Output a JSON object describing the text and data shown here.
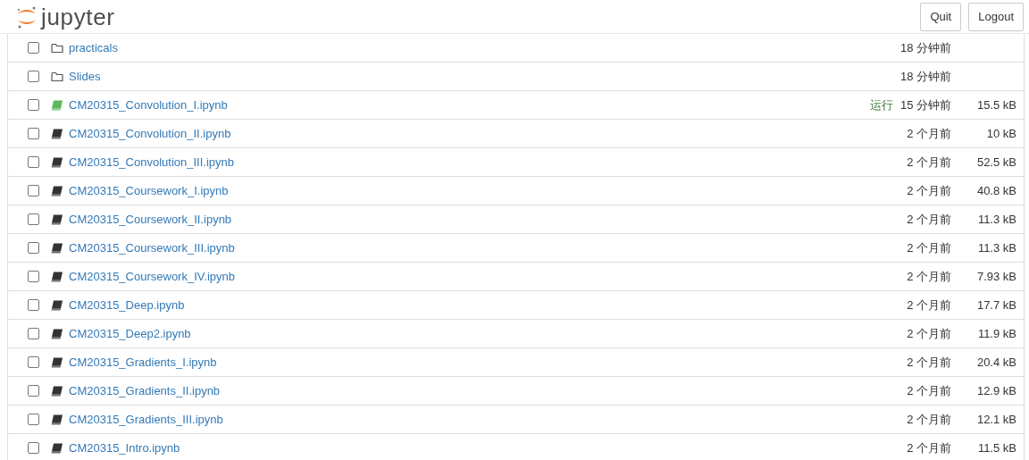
{
  "header": {
    "logo_text": "jupyter",
    "buttons": [
      "Quit",
      "Logout"
    ]
  },
  "items": [
    {
      "kind": "folder",
      "name": "practicals",
      "checked": false,
      "modified": "18 分钟前"
    },
    {
      "kind": "folder",
      "name": "Slides",
      "checked": false,
      "modified": "18 分钟前"
    },
    {
      "kind": "notebook",
      "name": "CM20315_Convolution_I.ipynb",
      "checked": false,
      "running": true,
      "status": "运行",
      "modified": "15 分钟前",
      "size": "15.5 kB"
    },
    {
      "kind": "notebook",
      "name": "CM20315_Convolution_II.ipynb",
      "checked": false,
      "running": false,
      "modified": "2 个月前",
      "size": "10 kB"
    },
    {
      "kind": "notebook",
      "name": "CM20315_Convolution_III.ipynb",
      "checked": false,
      "running": false,
      "modified": "2 个月前",
      "size": "52.5 kB"
    },
    {
      "kind": "notebook",
      "name": "CM20315_Coursework_I.ipynb",
      "checked": false,
      "running": false,
      "modified": "2 个月前",
      "size": "40.8 kB"
    },
    {
      "kind": "notebook",
      "name": "CM20315_Coursework_II.ipynb",
      "checked": false,
      "running": false,
      "modified": "2 个月前",
      "size": "11.3 kB"
    },
    {
      "kind": "notebook",
      "name": "CM20315_Coursework_III.ipynb",
      "checked": false,
      "running": false,
      "modified": "2 个月前",
      "size": "11.3 kB"
    },
    {
      "kind": "notebook",
      "name": "CM20315_Coursework_IV.ipynb",
      "checked": false,
      "running": false,
      "modified": "2 个月前",
      "size": "7.93 kB"
    },
    {
      "kind": "notebook",
      "name": "CM20315_Deep.ipynb",
      "checked": false,
      "running": false,
      "modified": "2 个月前",
      "size": "17.7 kB"
    },
    {
      "kind": "notebook",
      "name": "CM20315_Deep2.ipynb",
      "checked": false,
      "running": false,
      "modified": "2 个月前",
      "size": "11.9 kB"
    },
    {
      "kind": "notebook",
      "name": "CM20315_Gradients_I.ipynb",
      "checked": false,
      "running": false,
      "modified": "2 个月前",
      "size": "20.4 kB"
    },
    {
      "kind": "notebook",
      "name": "CM20315_Gradients_II.ipynb",
      "checked": false,
      "running": false,
      "modified": "2 个月前",
      "size": "12.9 kB"
    },
    {
      "kind": "notebook",
      "name": "CM20315_Gradients_III.ipynb",
      "checked": false,
      "running": false,
      "modified": "2 个月前",
      "size": "12.1 kB"
    },
    {
      "kind": "notebook",
      "name": "CM20315_Intro.ipynb",
      "checked": false,
      "running": false,
      "modified": "2 个月前",
      "size": "11.5 kB"
    }
  ]
}
